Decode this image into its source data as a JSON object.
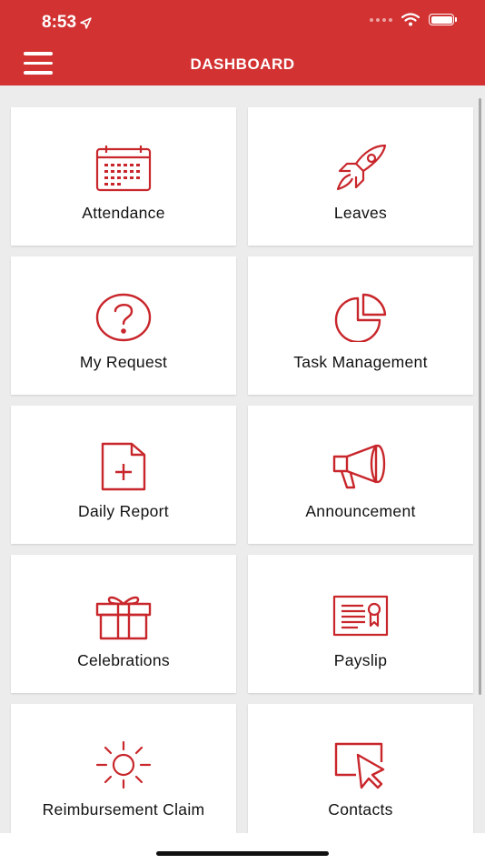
{
  "status_bar": {
    "time": "8:53"
  },
  "header": {
    "title": "DASHBOARD"
  },
  "tiles": [
    {
      "label": "Attendance",
      "icon": "calendar-icon"
    },
    {
      "label": "Leaves",
      "icon": "rocket-icon"
    },
    {
      "label": "My Request",
      "icon": "question-icon"
    },
    {
      "label": "Task Management",
      "icon": "pie-chart-icon"
    },
    {
      "label": "Daily Report",
      "icon": "file-add-icon"
    },
    {
      "label": "Announcement",
      "icon": "megaphone-icon"
    },
    {
      "label": "Celebrations",
      "icon": "gift-icon"
    },
    {
      "label": "Payslip",
      "icon": "certificate-icon"
    },
    {
      "label": "Reimbursement Claim",
      "icon": "sun-icon"
    },
    {
      "label": "Contacts",
      "icon": "cursor-screen-icon"
    }
  ],
  "colors": {
    "accent": "#d23232",
    "background": "#ececec",
    "tile": "#ffffff"
  }
}
